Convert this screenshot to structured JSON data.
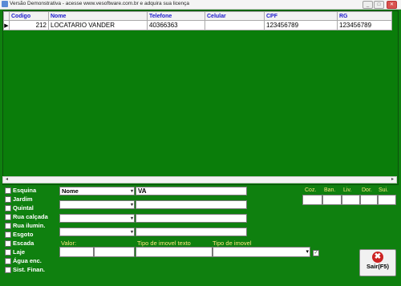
{
  "window": {
    "title": "Versão Demonstrativa - acesse www.vesoftware.com.br e adquira sua licença",
    "min_btn": "_",
    "max_btn": "□",
    "close_btn": "✕"
  },
  "grid": {
    "columns": [
      "Codigo",
      "Nome",
      "Telefone",
      "Celular",
      "CPF",
      "RG"
    ],
    "rows": [
      {
        "indicator": "▶",
        "codigo": "212",
        "nome": "LOCATARIO VANDER",
        "telefone": "40366363",
        "celular": "",
        "cpf": "123456789",
        "rg": "123456789"
      }
    ]
  },
  "checkboxes": [
    "Esquina",
    "Jardim",
    "Quintal",
    "Rua calçada",
    "Rua ilumin.",
    "Esgoto",
    "Escada",
    "Laje",
    "Água enc.",
    "Sist. Finan."
  ],
  "filters": {
    "field1_label": "Nome",
    "field1_value": "VA",
    "field2_label": "",
    "field3_label": "",
    "field4_label": "",
    "dropdown_arrow": "▾"
  },
  "counts": {
    "labels": [
      "Coz.",
      "Ban.",
      "Liv.",
      "Dor.",
      "Sui."
    ]
  },
  "bottom": {
    "valor_label": "Valor:",
    "tipo_texto_label": "Tipo de imovel texto",
    "tipo_label": "Tipo de imovel"
  },
  "sair": {
    "label": "Sair(F5)"
  }
}
